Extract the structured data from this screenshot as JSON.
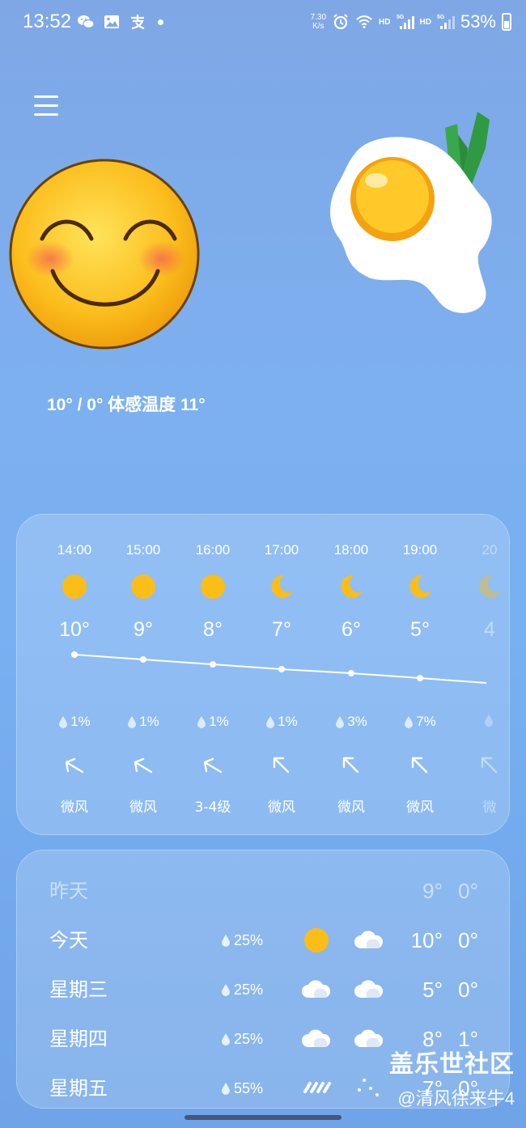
{
  "status_bar": {
    "time": "13:52",
    "net_speed_value": "7.30",
    "net_speed_unit": "K/s",
    "hd1": "HD",
    "hd2": "HD",
    "battery": "53%"
  },
  "current": {
    "summary": "10° / 0° 体感温度 11°"
  },
  "hourly": [
    {
      "time": "14:00",
      "icon": "sun-icon",
      "temp": "10°",
      "rain": "1%",
      "wind": "微风"
    },
    {
      "time": "15:00",
      "icon": "sun-icon",
      "temp": "9°",
      "rain": "1%",
      "wind": "微风"
    },
    {
      "time": "16:00",
      "icon": "sun-icon",
      "temp": "8°",
      "rain": "1%",
      "wind": "3-4级"
    },
    {
      "time": "17:00",
      "icon": "moon-icon",
      "temp": "7°",
      "rain": "1%",
      "wind": "微风"
    },
    {
      "time": "18:00",
      "icon": "moon-icon",
      "temp": "6°",
      "rain": "3%",
      "wind": "微风"
    },
    {
      "time": "19:00",
      "icon": "moon-icon",
      "temp": "5°",
      "rain": "7%",
      "wind": "微风"
    },
    {
      "time": "20",
      "icon": "moon-icon",
      "temp": "4",
      "rain": "",
      "wind": "微"
    }
  ],
  "daily": [
    {
      "day": "昨天",
      "rain": "",
      "high": "9°",
      "low": "0°"
    },
    {
      "day": "今天",
      "rain": "25%",
      "icon_day": "sun-icon",
      "icon_night": "cloud-icon",
      "high": "10°",
      "low": "0°"
    },
    {
      "day": "星期三",
      "rain": "25%",
      "icon_day": "cloud-icon",
      "icon_night": "cloud-icon",
      "high": "5°",
      "low": "0°"
    },
    {
      "day": "星期四",
      "rain": "25%",
      "icon_day": "cloud-icon",
      "icon_night": "cloud-icon",
      "high": "8°",
      "low": "1°"
    },
    {
      "day": "星期五",
      "rain": "55%",
      "icon_day": "rain-icon",
      "icon_night": "snow-icon",
      "high": "7°",
      "low": "0°"
    }
  ],
  "watermark": {
    "line1": "盖乐世社区",
    "line2": "@清风徐来牛4"
  },
  "colors": {
    "sun": "#fbbd17",
    "background": "#7db0ef"
  }
}
